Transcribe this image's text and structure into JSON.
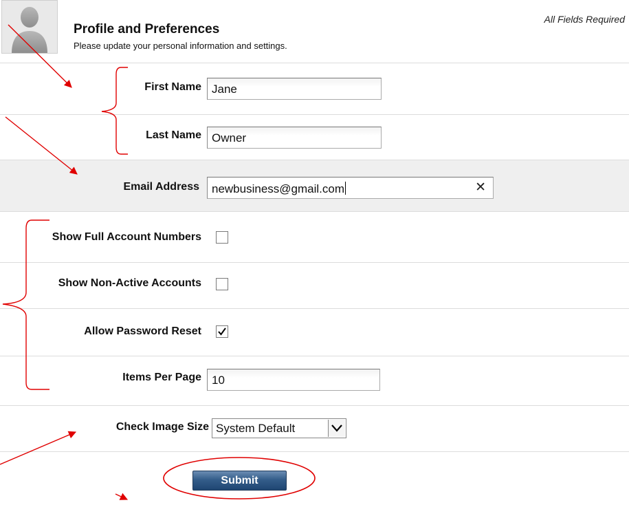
{
  "header": {
    "title": "Profile and Preferences",
    "subtitle": "Please update your personal information and settings.",
    "required_note": "All Fields Required"
  },
  "form": {
    "first_name": {
      "label": "First Name",
      "value": "Jane"
    },
    "last_name": {
      "label": "Last Name",
      "value": "Owner"
    },
    "email": {
      "label": "Email Address",
      "value": "newbusiness@gmail.com",
      "clear_glyph": "✕"
    },
    "show_full_account_numbers": {
      "label": "Show Full Account Numbers",
      "checked": false
    },
    "show_non_active_accounts": {
      "label": "Show Non-Active Accounts",
      "checked": false
    },
    "allow_password_reset": {
      "label": "Allow Password Reset",
      "checked": true
    },
    "items_per_page": {
      "label": "Items Per Page",
      "value": "10"
    },
    "check_image_size": {
      "label": "Check Image Size",
      "value": "System Default"
    },
    "submit_label": "Submit"
  },
  "colors": {
    "annotation": "#e00000",
    "row_divider": "#dcdcdc",
    "shaded_row": "#efefef",
    "submit_button": "#2f5785"
  },
  "icons": {
    "avatar": "person-silhouette-icon",
    "clear": "close-icon",
    "checkbox_checked": "checkmark-icon",
    "select": "chevron-down-icon"
  }
}
